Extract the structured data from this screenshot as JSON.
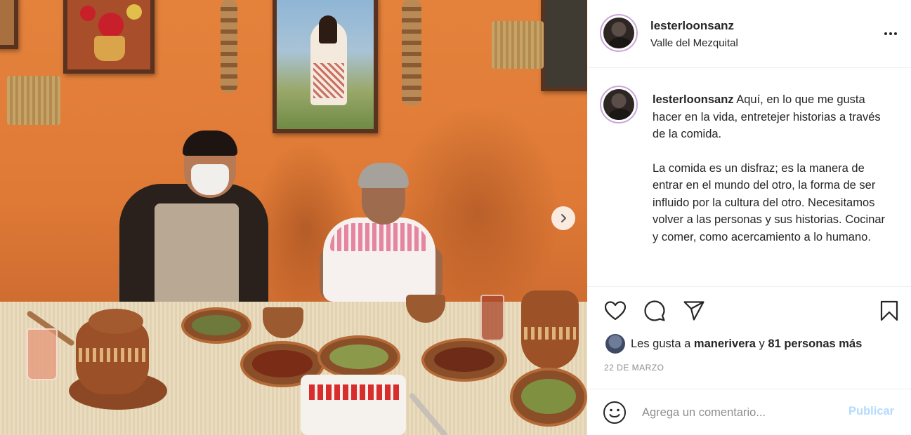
{
  "post": {
    "username": "lesterloonsanz",
    "location": "Valle del Mezquital",
    "caption": {
      "username": "lesterloonsanz",
      "paragraph1": "Aquí, en lo que me gusta hacer en la vida, entretejer historias a través de la comida.",
      "paragraph2": "La comida es un disfraz; es la manera de entrar en el mundo del otro, la forma de ser influido por la cultura del otro. Necesitamos volver a las personas y sus historias. Cocinar y comer, como acercamiento a lo humano."
    },
    "likes": {
      "prefix": "Les gusta a ",
      "user": "manerivera",
      "middle": " y ",
      "others": "81 personas más"
    },
    "date": "22 DE MARZO",
    "comment": {
      "placeholder": "Agrega un comentario...",
      "publish_label": "Publicar"
    }
  },
  "icons": {
    "more": "more-options-icon",
    "like": "heart-icon",
    "comment": "comment-bubble-icon",
    "share": "paper-plane-icon",
    "save": "bookmark-icon",
    "emoji": "smiley-icon",
    "next": "chevron-right-icon"
  },
  "colors": {
    "publish_disabled": "#b3dbff",
    "story_ring": "#c9a6d9",
    "wall": "#e4823c"
  }
}
